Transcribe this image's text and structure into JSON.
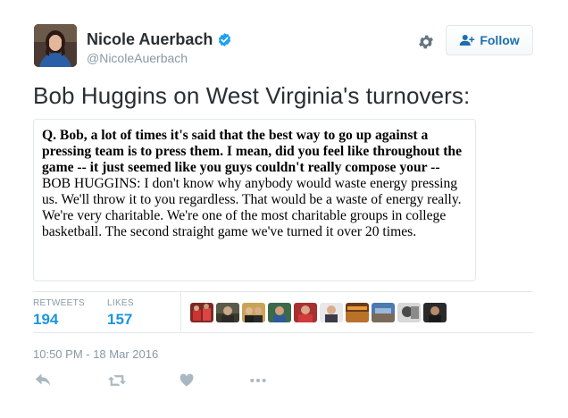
{
  "author": {
    "name": "Nicole Auerbach",
    "handle": "@NicoleAuerbach",
    "verified_icon": "verified-badge-icon"
  },
  "header": {
    "settings_icon": "gear-icon",
    "follow_label": "Follow"
  },
  "tweet": {
    "text": "Bob Huggins on West Virginia's turnovers:",
    "quote_question": "Q. Bob, a lot of times it's said that the best way to go up against a pressing team is to press them. I mean, did you feel like throughout the game -- it just seemed like you guys couldn't really compose your --",
    "quote_answer": "BOB HUGGINS: I don't know why anybody would waste energy pressing us. We'll throw it to you regardless. That would be a waste of energy really. We're very charitable. We're one of the most charitable groups in college basketball. The second straight game we've turned it over 20 times."
  },
  "stats": {
    "retweets_label": "RETWEETS",
    "retweets_count": "194",
    "likes_label": "LIKES",
    "likes_count": "157"
  },
  "timestamp": "10:50 PM - 18 Mar 2016",
  "actions": [
    "reply-icon",
    "retweet-icon",
    "like-icon",
    "more-icon"
  ],
  "colors": {
    "accent": "#1b95e0",
    "text": "#292f33",
    "muted": "#8899a6",
    "border": "#e1e8ed"
  }
}
